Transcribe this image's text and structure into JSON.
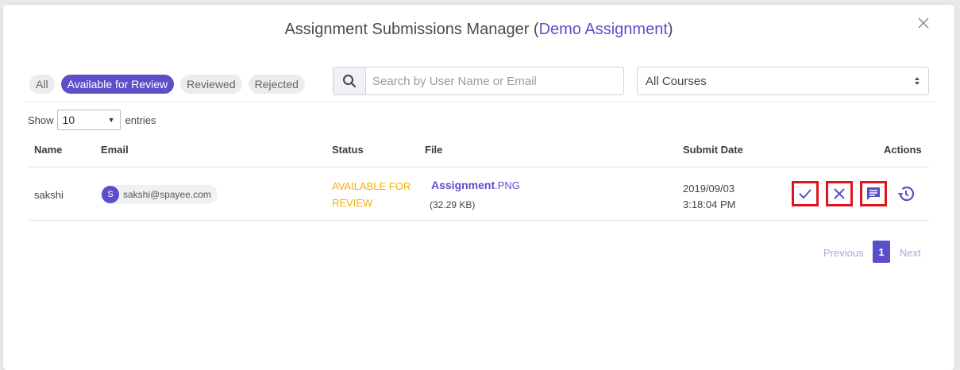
{
  "modal": {
    "title_prefix": "Assignment Submissions Manager (",
    "title_accent": "Demo Assignment",
    "title_suffix": ")"
  },
  "tabs": [
    {
      "label": "All",
      "active": false
    },
    {
      "label": "Available for Review",
      "active": true
    },
    {
      "label": "Reviewed",
      "active": false
    },
    {
      "label": "Rejected",
      "active": false
    }
  ],
  "search": {
    "placeholder": "Search by User Name or Email",
    "value": ""
  },
  "course_filter": {
    "selected": "All Courses"
  },
  "entries": {
    "show_label": "Show",
    "value": "10",
    "suffix": "entries"
  },
  "table": {
    "headers": {
      "name": "Name",
      "email": "Email",
      "status": "Status",
      "file": "File",
      "submit_date": "Submit Date",
      "actions": "Actions"
    },
    "rows": [
      {
        "name": "sakshi",
        "avatar_letter": "S",
        "email": "sakshi@spayee.com",
        "status_line1": "AVAILABLE FOR",
        "status_line2": "REVIEW",
        "file_name": "Assignment",
        "file_ext": ".PNG",
        "file_size": "(32.29 KB)",
        "date": "2019/09/03",
        "time": "3:18:04 PM"
      }
    ]
  },
  "pagination": {
    "previous": "Previous",
    "page": "1",
    "next": "Next"
  },
  "colors": {
    "accent": "#5b4fc9",
    "status_available": "#f3b000",
    "highlight_border": "#e0141e"
  }
}
